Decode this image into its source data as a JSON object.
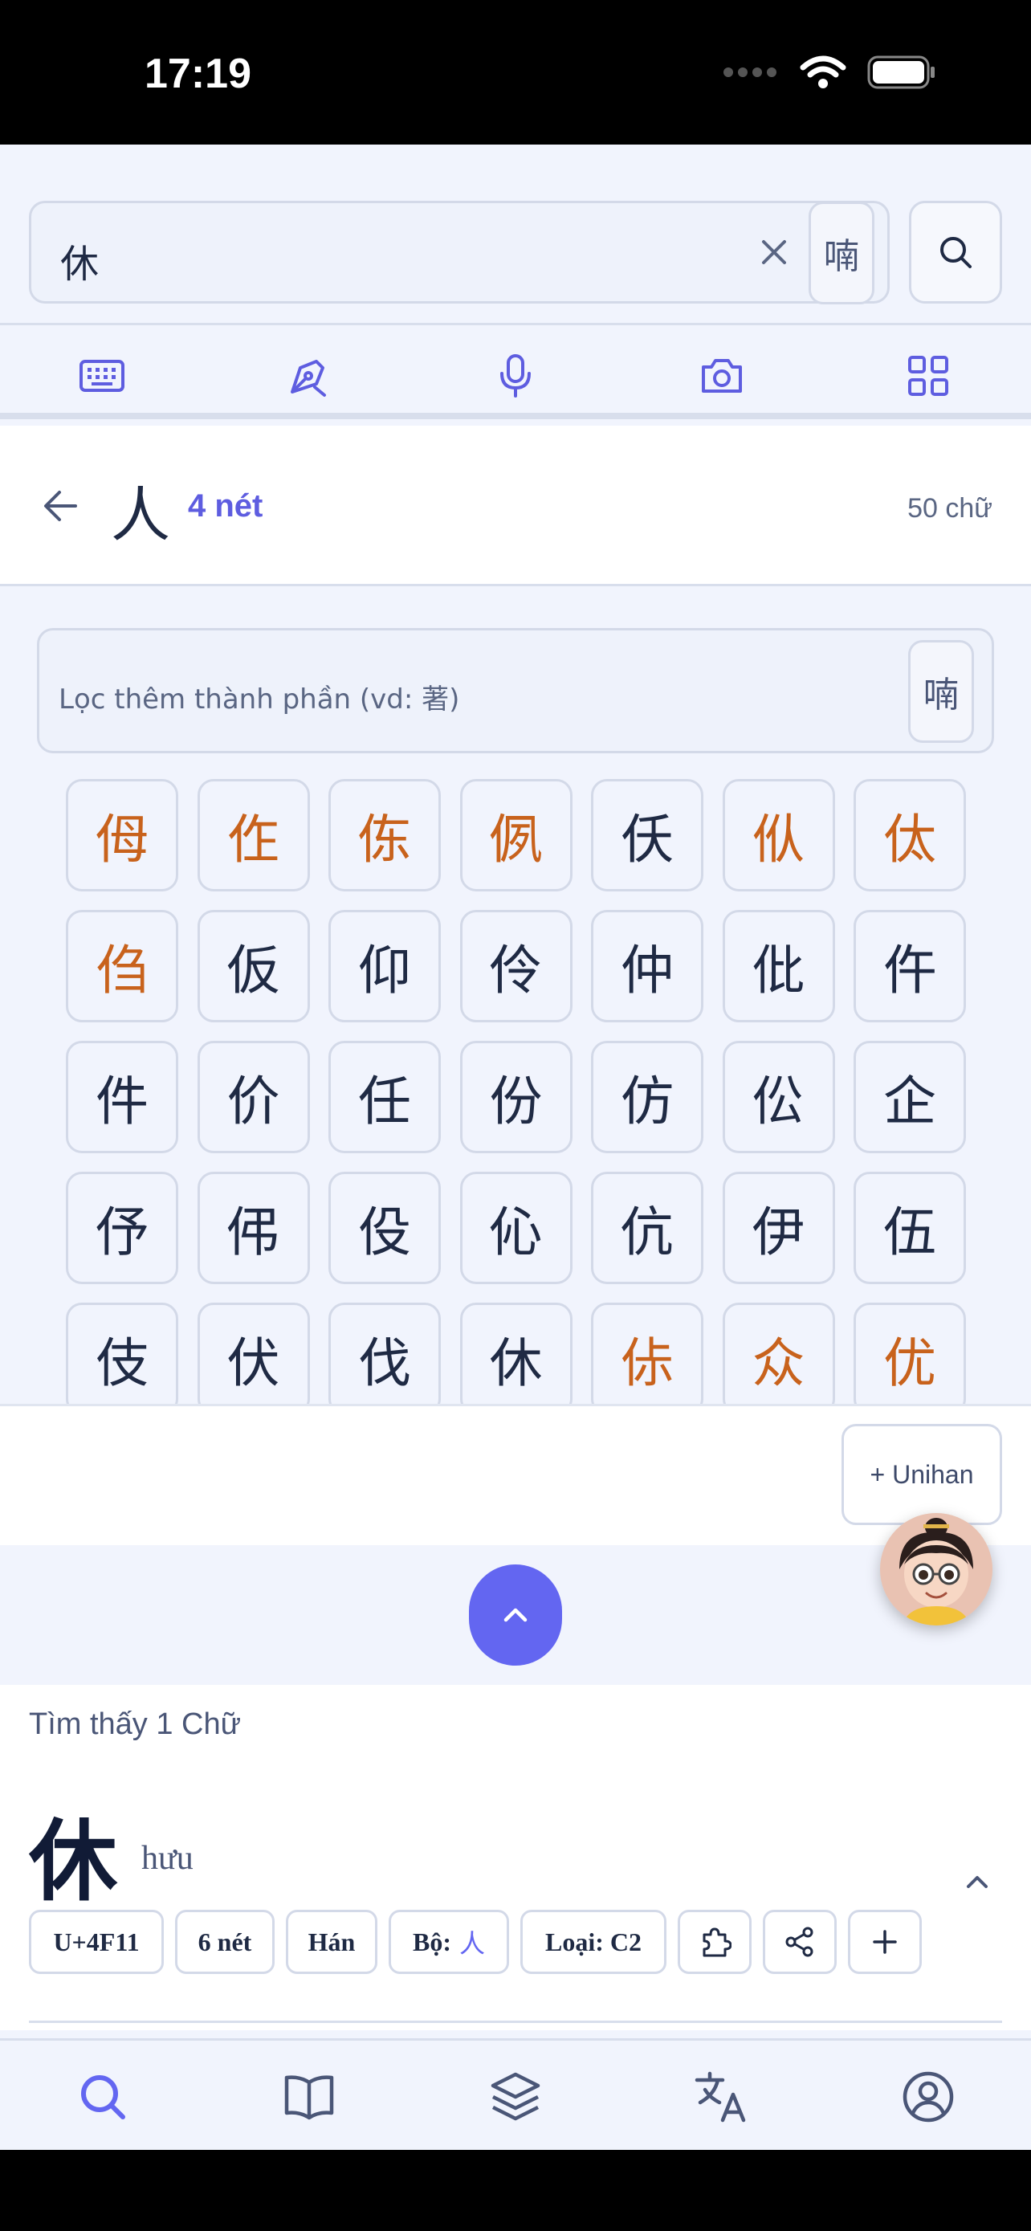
{
  "status_bar": {
    "time": "17:19"
  },
  "search": {
    "value": "休",
    "radical_button": "喃"
  },
  "radical_header": {
    "radical": "人",
    "strokes": "4 nét",
    "count": "50 chữ"
  },
  "filter": {
    "placeholder": "Lọc thêm thành phần (vd: 著)",
    "radical_button": "喃"
  },
  "characters": [
    {
      "c": "㑄",
      "o": true
    },
    {
      "c": "㑅",
      "o": true
    },
    {
      "c": "㑈",
      "o": true
    },
    {
      "c": "㑉",
      "o": true
    },
    {
      "c": "仸",
      "o": false
    },
    {
      "c": "㐺",
      "o": true
    },
    {
      "c": "㑀",
      "o": true
    },
    {
      "c": "㑇",
      "o": true
    },
    {
      "c": "仮",
      "o": false
    },
    {
      "c": "仰",
      "o": false
    },
    {
      "c": "伶",
      "o": false
    },
    {
      "c": "仲",
      "o": false
    },
    {
      "c": "仳",
      "o": false
    },
    {
      "c": "仵",
      "o": false
    },
    {
      "c": "件",
      "o": false
    },
    {
      "c": "价",
      "o": false
    },
    {
      "c": "任",
      "o": false
    },
    {
      "c": "份",
      "o": false
    },
    {
      "c": "仿",
      "o": false
    },
    {
      "c": "伀",
      "o": false
    },
    {
      "c": "企",
      "o": false
    },
    {
      "c": "伃",
      "o": false
    },
    {
      "c": "伄",
      "o": false
    },
    {
      "c": "伇",
      "o": false
    },
    {
      "c": "伈",
      "o": false
    },
    {
      "c": "伉",
      "o": false
    },
    {
      "c": "伊",
      "o": false
    },
    {
      "c": "伍",
      "o": false
    },
    {
      "c": "伎",
      "o": false
    },
    {
      "c": "伏",
      "o": false
    },
    {
      "c": "伐",
      "o": false
    },
    {
      "c": "休",
      "o": false
    },
    {
      "c": "㑐",
      "o": true
    },
    {
      "c": "众",
      "o": true
    },
    {
      "c": "优",
      "o": true
    }
  ],
  "unihan_button": "+ Unihan",
  "result": {
    "found_text": "Tìm thấy 1 Chữ",
    "character": "休",
    "reading": "hưu",
    "tags": {
      "codepoint": "U+4F11",
      "strokes": "6 nét",
      "type": "Hán",
      "radical_label": "Bộ:",
      "radical_value": "人",
      "category": "Loại: C2"
    }
  },
  "colors": {
    "accent": "#6366f1",
    "orange": "#c8621c",
    "text": "#1f2a44"
  },
  "bottom_nav": [
    "search-icon",
    "book-icon",
    "layers-icon",
    "translate-icon",
    "profile-icon"
  ]
}
